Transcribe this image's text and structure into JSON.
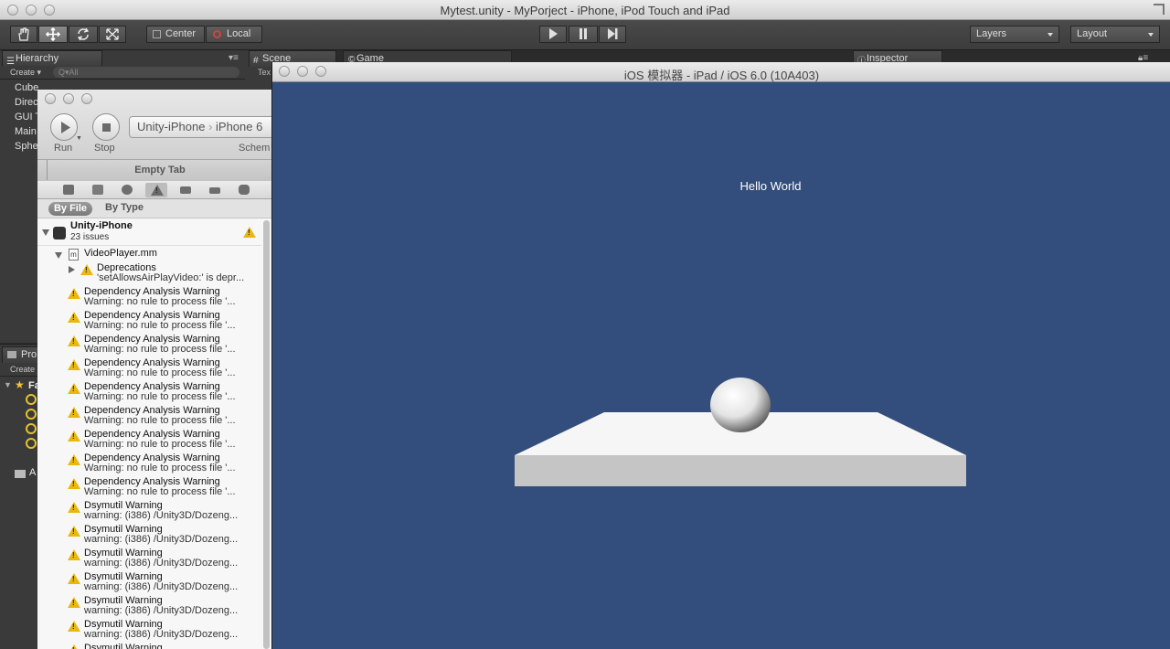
{
  "window": {
    "title": "Mytest.unity - MyPorject - iPhone, iPod Touch and iPad"
  },
  "toolbar": {
    "pivot_label": "Center",
    "space_label": "Local",
    "layers_label": "Layers",
    "layout_label": "Layout"
  },
  "hierarchy": {
    "tab_label": "Hierarchy",
    "create_label": "Create",
    "search_placeholder": "Q▾All",
    "items": [
      "Cube",
      "Direc",
      "GUI T",
      "Main",
      "Sphe"
    ]
  },
  "scene_tab": {
    "label": "Scene",
    "sub_label": "Tex"
  },
  "game_tab": {
    "label": "Game"
  },
  "inspector_tab": {
    "label": "Inspector"
  },
  "project": {
    "tab_label": "Pro",
    "create_label": "Create",
    "favorites_label": "Fa",
    "assets_label": "A"
  },
  "xcode": {
    "run_label": "Run",
    "stop_label": "Stop",
    "scheme_project": "Unity-iPhone",
    "scheme_device": "iPhone 6",
    "scheme_label": "Schem",
    "empty_tab": "Empty Tab",
    "filter_by_file": "By File",
    "filter_by_type": "By Type",
    "project_name": "Unity-iPhone",
    "project_issues": "23 issues",
    "file_name": "VideoPlayer.mm",
    "deprecation_title": "Deprecations",
    "deprecation_detail": "'setAllowsAirPlayVideo:' is depr...",
    "issues": [
      {
        "title": "Dependency Analysis Warning",
        "detail": "Warning: no rule to process file '..."
      },
      {
        "title": "Dependency Analysis Warning",
        "detail": "Warning: no rule to process file '..."
      },
      {
        "title": "Dependency Analysis Warning",
        "detail": "Warning: no rule to process file '..."
      },
      {
        "title": "Dependency Analysis Warning",
        "detail": "Warning: no rule to process file '..."
      },
      {
        "title": "Dependency Analysis Warning",
        "detail": "Warning: no rule to process file '..."
      },
      {
        "title": "Dependency Analysis Warning",
        "detail": "Warning: no rule to process file '..."
      },
      {
        "title": "Dependency Analysis Warning",
        "detail": "Warning: no rule to process file '..."
      },
      {
        "title": "Dependency Analysis Warning",
        "detail": "Warning: no rule to process file '..."
      },
      {
        "title": "Dependency Analysis Warning",
        "detail": "Warning: no rule to process file '..."
      },
      {
        "title": "Dsymutil Warning",
        "detail": "warning: (i386) /Unity3D/Dozeng..."
      },
      {
        "title": "Dsymutil Warning",
        "detail": "warning: (i386) /Unity3D/Dozeng..."
      },
      {
        "title": "Dsymutil Warning",
        "detail": "warning: (i386) /Unity3D/Dozeng..."
      },
      {
        "title": "Dsymutil Warning",
        "detail": "warning: (i386) /Unity3D/Dozeng..."
      },
      {
        "title": "Dsymutil Warning",
        "detail": "warning: (i386) /Unity3D/Dozeng..."
      },
      {
        "title": "Dsymutil Warning",
        "detail": "warning: (i386) /Unity3D/Dozeng..."
      },
      {
        "title": "Dsymutil Warning",
        "detail": ""
      }
    ]
  },
  "simulator": {
    "title": "iOS 模拟器 - iPad / iOS 6.0 (10A403)",
    "label_text": "Hello World",
    "background_color": "#334e7c"
  }
}
